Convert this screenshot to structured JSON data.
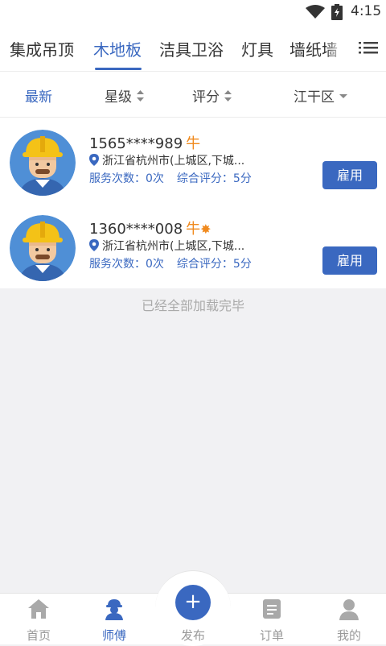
{
  "status_bar": {
    "time": "4:15",
    "wifi_icon": "wifi-icon",
    "battery_icon": "battery-charging-icon"
  },
  "category_tabs": [
    {
      "label": "集成吊顶",
      "active": false
    },
    {
      "label": "木地板",
      "active": true
    },
    {
      "label": "洁具卫浴",
      "active": false
    },
    {
      "label": "灯具",
      "active": false
    },
    {
      "label": "墙纸墙",
      "active": false
    }
  ],
  "category_menu_icon": "list-menu-icon",
  "filters": [
    {
      "label": "最新",
      "active": true
    },
    {
      "label": "星级",
      "icon": "sort-icon"
    },
    {
      "label": "评分",
      "icon": "sort-icon"
    },
    {
      "label": "江干区",
      "icon": "dropdown-icon"
    }
  ],
  "workers": [
    {
      "phone": "1565****989",
      "badge": "牛",
      "location": "浙江省杭州市(上城区,下城...",
      "service_count": "服务次数：0次",
      "rating": "综合评分：5分",
      "hire_label": "雇用"
    },
    {
      "phone": "1360****008",
      "badge": "牛",
      "badge_extra": "✸",
      "location": "浙江省杭州市(上城区,下城...",
      "service_count": "服务次数：0次",
      "rating": "综合评分：5分",
      "hire_label": "雇用"
    }
  ],
  "load_status": "已经全部加载完毕",
  "bottom_nav": [
    {
      "label": "首页",
      "icon": "home-icon",
      "active": false
    },
    {
      "label": "师傅",
      "icon": "worker-icon",
      "active": true
    },
    {
      "label": "发布",
      "icon": "plus-icon",
      "active": false
    },
    {
      "label": "订单",
      "icon": "order-icon",
      "active": false
    },
    {
      "label": "我的",
      "icon": "profile-icon",
      "active": false
    }
  ],
  "colors": {
    "accent": "#3a68c0",
    "badge": "#f08a1e",
    "background": "#f1f1f3"
  }
}
